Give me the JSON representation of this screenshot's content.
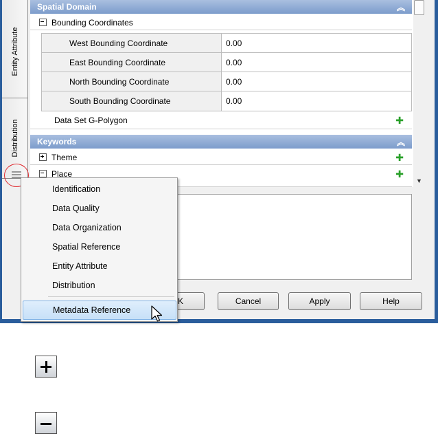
{
  "tabs": {
    "entity_attribute": "Entity Attribute",
    "distribution": "Distribution"
  },
  "spatial_domain": {
    "title": "Spatial Domain",
    "group_label": "Bounding Coordinates",
    "coords": [
      {
        "label": "West Bounding Coordinate",
        "value": "0.00"
      },
      {
        "label": "East Bounding Coordinate",
        "value": "0.00"
      },
      {
        "label": "North Bounding Coordinate",
        "value": "0.00"
      },
      {
        "label": "South Bounding Coordinate",
        "value": "0.00"
      }
    ],
    "polygon_label": "Data Set G-Polygon"
  },
  "keywords": {
    "title": "Keywords",
    "theme_label": "Theme",
    "place_label": "Place"
  },
  "menu": {
    "items": [
      "Identification",
      "Data Quality",
      "Data Organization",
      "Spatial Reference",
      "Entity Attribute",
      "Distribution"
    ],
    "selected": "Metadata Reference"
  },
  "buttons": {
    "ok": "K",
    "cancel": "Cancel",
    "apply": "Apply",
    "help": "Help"
  },
  "icons": {
    "collapse": "double-chevron-up-icon",
    "add": "green-plus-icon",
    "expand_big": "plus-box-icon",
    "collapse_big": "minus-box-icon"
  },
  "colors": {
    "section_header": "#7c9ccc",
    "window_frame": "#2a5d9c",
    "highlight_circle": "#e0282e",
    "add_icon": "#2aa02a"
  }
}
